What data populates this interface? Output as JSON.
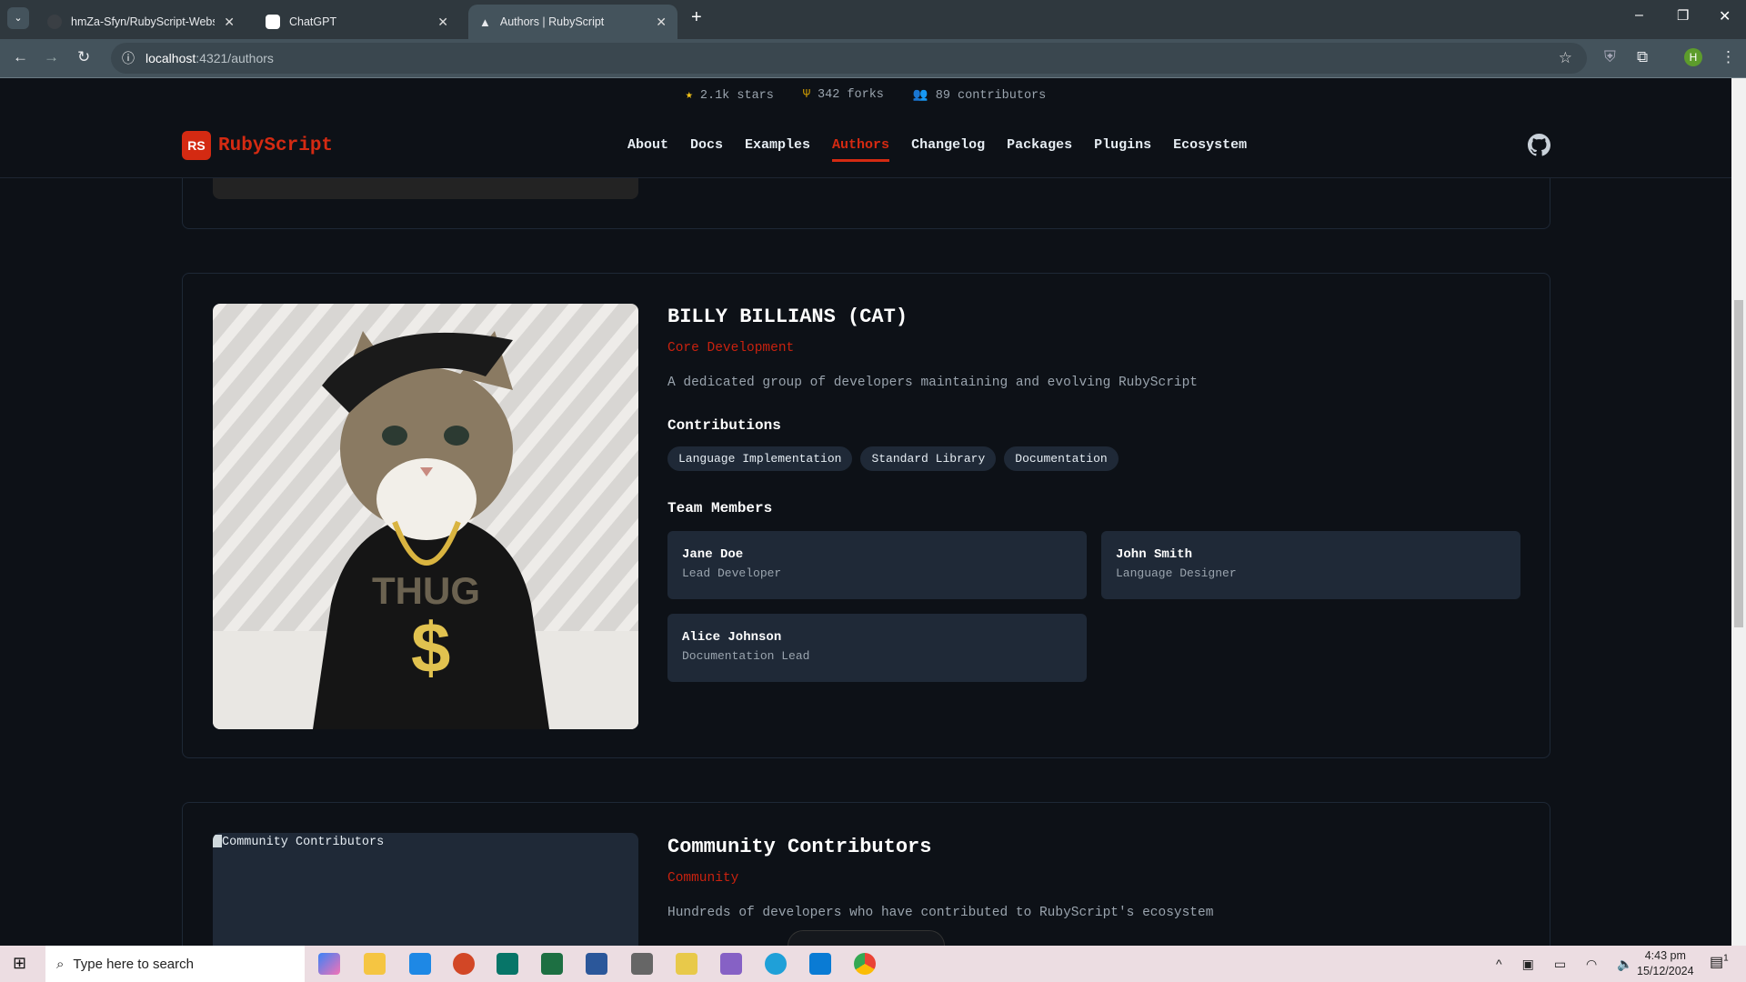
{
  "browser": {
    "tabs": [
      {
        "title": "hmZa-Sfyn/RubyScript-Website",
        "icon": "github-icon",
        "active": false
      },
      {
        "title": "ChatGPT",
        "icon": "chatgpt-icon",
        "active": false
      },
      {
        "title": "Authors | RubyScript",
        "icon": "astro-icon",
        "active": true
      }
    ],
    "url_host": "localhost",
    "url_rest": ":4321/authors",
    "profile_initial": "H"
  },
  "stats": {
    "stars": "2.1k stars",
    "forks": "342 forks",
    "contributors": "89 contributors"
  },
  "nav": {
    "logo_badge": "RS",
    "brand": "RubyScript",
    "links": [
      "About",
      "Docs",
      "Examples",
      "Authors",
      "Changelog",
      "Packages",
      "Plugins",
      "Ecosystem"
    ],
    "active": "Authors"
  },
  "authors": [
    {
      "name": "BILLY BILLIANS (CAT)",
      "role": "Core Development",
      "description": "A dedicated group of developers maintaining and evolving RubyScript",
      "contributions_heading": "Contributions",
      "contributions": [
        "Language Implementation",
        "Standard Library",
        "Documentation"
      ],
      "team_heading": "Team Members",
      "members": [
        {
          "name": "Jane Doe",
          "role": "Lead Developer"
        },
        {
          "name": "John Smith",
          "role": "Language Designer"
        },
        {
          "name": "Alice Johnson",
          "role": "Documentation Lead"
        }
      ]
    },
    {
      "name": "Community Contributors",
      "role": "Community",
      "description": "Hundreds of developers who have contributed to RubyScript's ecosystem",
      "image_alt": "Community Contributors"
    }
  ],
  "taskbar": {
    "search_placeholder": "Type here to search",
    "time": "4:43 pm",
    "date": "15/12/2024",
    "notifications": "1"
  },
  "colors": {
    "accent": "#d42a12",
    "bg": "#0d1117",
    "card": "#1f2937"
  }
}
